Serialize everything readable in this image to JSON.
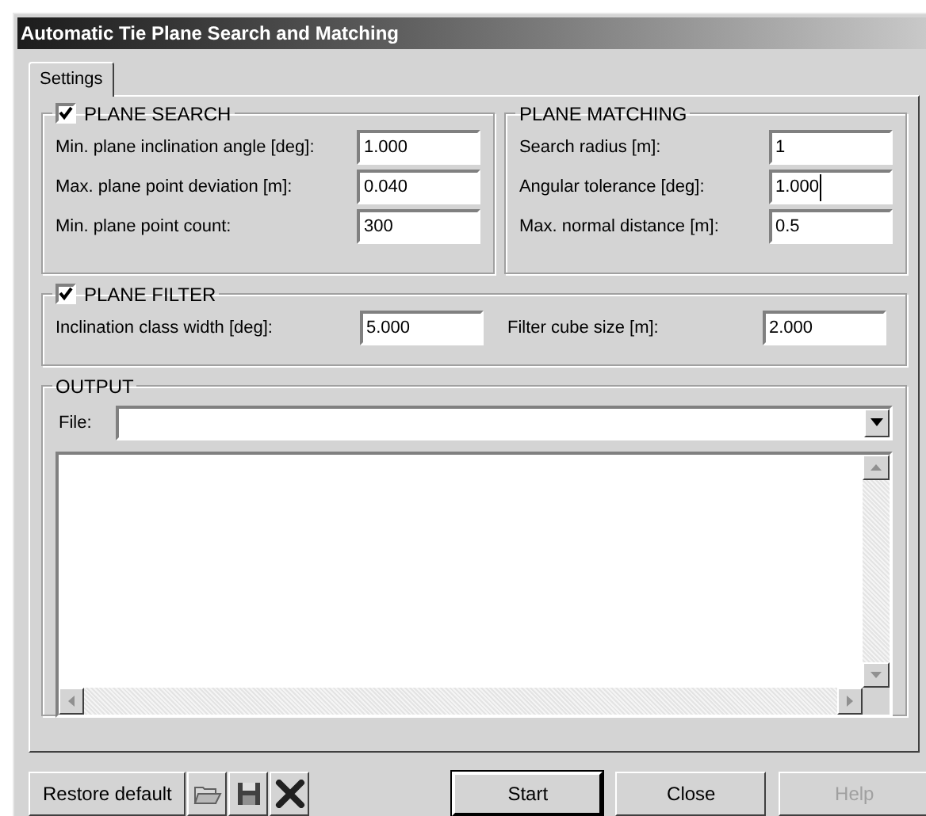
{
  "window": {
    "title": "Automatic Tie Plane Search and Matching"
  },
  "tabs": [
    {
      "label": "Settings",
      "selected": true
    }
  ],
  "plane_search": {
    "title": "PLANE SEARCH",
    "checked": true,
    "fields": [
      {
        "label": "Min. plane inclination angle [deg]:",
        "value": "1.000",
        "focused": false
      },
      {
        "label": "Max. plane point deviation [m]:",
        "value": "0.040",
        "focused": false
      },
      {
        "label": "Min. plane point count:",
        "value": "300",
        "focused": false
      }
    ]
  },
  "plane_matching": {
    "title": "PLANE MATCHING",
    "fields": [
      {
        "label": "Search radius [m]:",
        "value": "1",
        "focused": false
      },
      {
        "label": "Angular tolerance [deg]:",
        "value": "1.000",
        "focused": true
      },
      {
        "label": "Max. normal distance [m]:",
        "value": "0.5",
        "focused": false
      }
    ]
  },
  "plane_filter": {
    "title": "PLANE FILTER",
    "checked": true,
    "fields": [
      {
        "label": "Inclination class width [deg]:",
        "value": "5.000",
        "focused": false
      },
      {
        "label": "Filter cube size [m]:",
        "value": "2.000",
        "focused": false
      }
    ]
  },
  "output": {
    "title": "OUTPUT",
    "file": {
      "label": "File:"
    }
  },
  "restore_button": {
    "label": "Restore default"
  },
  "toolbar": [
    {
      "kind": "open"
    },
    {
      "kind": "save"
    },
    {
      "kind": "delete"
    }
  ],
  "buttons": [
    {
      "label": "Start",
      "default": true,
      "disabled": false
    },
    {
      "label": "Close",
      "default": false,
      "disabled": false
    },
    {
      "label": "Help",
      "default": false,
      "disabled": true
    }
  ]
}
